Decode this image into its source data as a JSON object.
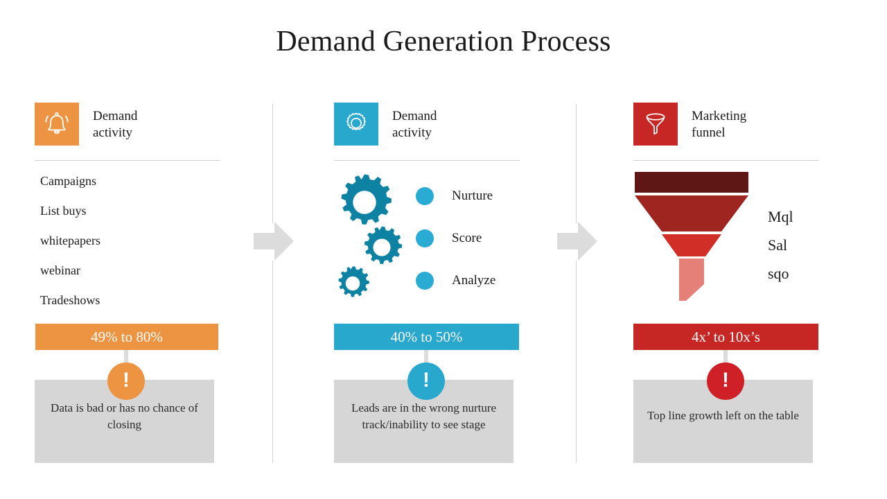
{
  "slide": {
    "title": "Demand Generation Process"
  },
  "colors": {
    "orange": "#ec9442",
    "blue": "#29a8ce",
    "red": "#c62725",
    "gear_teal": "#0e82a2",
    "bullet_blue": "#29abd4",
    "note_gray": "#d6d6d6",
    "arrow_gray": "#dcdcdc",
    "funnel_tier_1": "#5e1715",
    "funnel_tier_2": "#9e2520",
    "funnel_tier_3": "#d12e28",
    "funnel_tier_4": "#e58078"
  },
  "columns": [
    {
      "id": "demand-activity-sources",
      "icon": "bell-icon",
      "icon_tile_color": "#ec9442",
      "head_label": "Demand\nactivity",
      "items": [
        "Campaigns",
        "List buys",
        "whitepapers",
        "webinar",
        "Tradeshows"
      ],
      "metric_bar": "49% to 80%",
      "metric_bar_color": "#ec9442",
      "alert_symbol": "!",
      "alert_color": "#ec9442",
      "note": "Data is bad or has no chance of closing"
    },
    {
      "id": "demand-activity-processing",
      "icon": "gear-icon",
      "icon_tile_color": "#29a8ce",
      "head_label": "Demand\nactivity",
      "bullets": [
        "Nurture",
        "Score",
        "Analyze"
      ],
      "metric_bar": "40% to 50%",
      "metric_bar_color": "#29a8ce",
      "alert_symbol": "!",
      "alert_color": "#29a8ce",
      "note": "Leads are in the wrong nurture track/inability to see stage"
    },
    {
      "id": "marketing-funnel",
      "icon": "funnel-icon",
      "icon_tile_color": "#c62725",
      "head_label": "Marketing\nfunnel",
      "funnel_labels": [
        "Mql",
        "Sal",
        "sqo"
      ],
      "metric_bar": "4x’ to 10x’s",
      "metric_bar_color": "#c62725",
      "alert_symbol": "!",
      "alert_color": "#cf2027",
      "note": "Top line growth left on the table"
    }
  ],
  "connectors": [
    {
      "name": "arrow-stage-1-to-2",
      "icon": "right-arrow-icon"
    },
    {
      "name": "arrow-stage-2-to-3",
      "icon": "right-arrow-icon"
    }
  ]
}
